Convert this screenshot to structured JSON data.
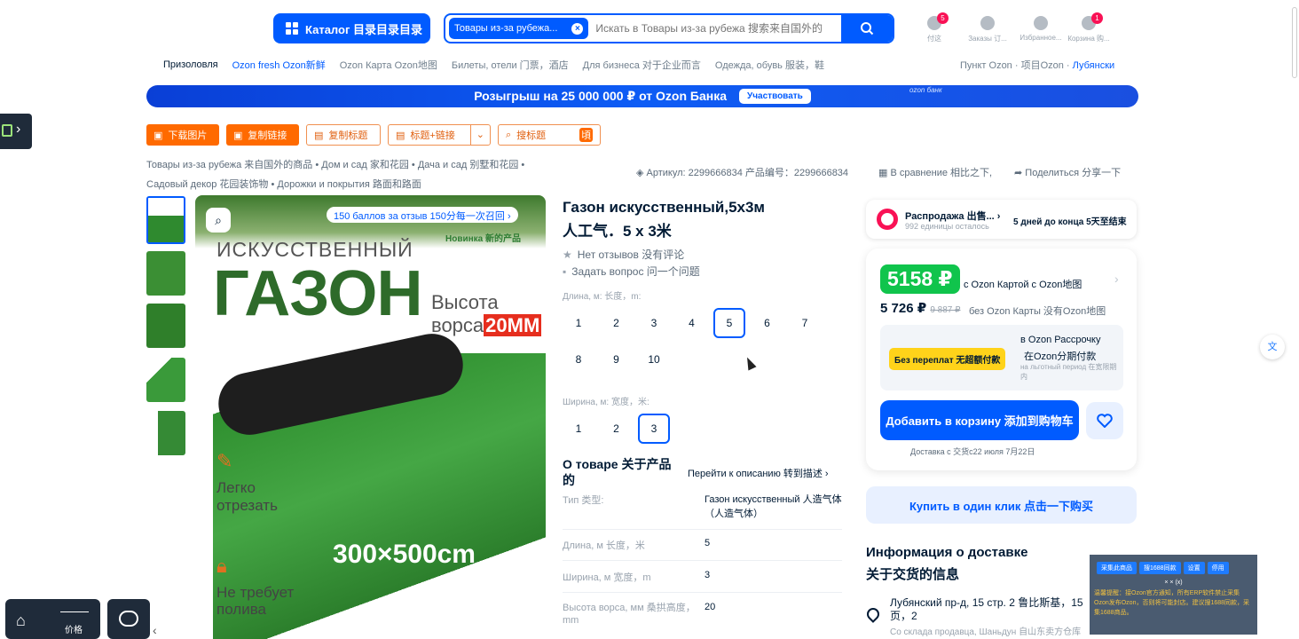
{
  "header": {
    "catalog_label": "Каталог 目录目录目录",
    "search_chip": "Товары из-за рубежа...",
    "search_placeholder": "Искать в Товары из-за рубежа 搜索来自国外的",
    "icons": [
      {
        "label": "付这",
        "badge": "5"
      },
      {
        "label": "Заказы 订...",
        "badge": ""
      },
      {
        "label": "Избранное...",
        "badge": ""
      },
      {
        "label": "Корзина 购...",
        "badge": "1"
      }
    ]
  },
  "subnav": {
    "items": [
      "Призоловля",
      "Ozon fresh Ozon新鲜",
      "Ozon Карта Ozon地图",
      "Билеты, отели 门票，酒店",
      "Для бизнеса 对于企业而言",
      "Одежда, обувь 服装，鞋"
    ],
    "pickup_prefix": "Пункт Ozon · 项目Ozon · ",
    "pickup_place": "Лубянски"
  },
  "banner": {
    "text": "Розыгрыш на 25 000 000 ₽ от Ozon Банка",
    "cta": "Участвовать",
    "logo": "ozon банк"
  },
  "toolbar": {
    "download": "下载图片",
    "copy_link": "复制链接",
    "copy_title": "复制标题",
    "title_link": "标题+链接",
    "search_title": "搜标题"
  },
  "breadcrumbs": {
    "line1": "Товары из-за рубежа 来自国外的商品 • Дом и сад 家和花园 • Дача и сад 别墅和花园 •",
    "line2": "Садовый декор 花园装饰物 • Дорожки и покрытия 路面和路面"
  },
  "meta": {
    "article": "Артикул: 2299666834 产品编号：2299666834",
    "compare": "В сравнение 相比之下,",
    "share": "Поделиться 分享一下"
  },
  "image": {
    "bonus": "150 баллов за отзыв 150分每一次召回",
    "new": "Новинка 新的产品",
    "word1": "ИСКУССТВЕННЫЙ",
    "word2": "ГАЗОН",
    "height1": "Высота",
    "height2": "ворса",
    "height_mm": "20MM",
    "feature1a": "Легко",
    "feature1b": "отрезать",
    "size": "300×500cm",
    "feature2a": "Не требует",
    "feature2b": "полива"
  },
  "product": {
    "title_line1": "Газон искусственный,5х3м",
    "title_line2": "人工气．5 x 3米",
    "reviews": "Нет отзывов 没有评论",
    "question": "Задать вопрос 问一个问题",
    "length_label": "Длина, м: 长度，m:",
    "length_options": [
      "1",
      "2",
      "3",
      "4",
      "5",
      "6",
      "7",
      "8",
      "9",
      "10"
    ],
    "length_selected": "5",
    "width_label": "Ширина, м: 宽度，米:",
    "width_options": [
      "1",
      "2",
      "3"
    ],
    "width_selected": "3"
  },
  "about": {
    "title": "О товаре 关于产品的",
    "link": "Перейти к описанию 转到描述",
    "specs": [
      {
        "k": "Тип 类型:",
        "v": "Газон искусственный 人造气体（人造气体）"
      },
      {
        "k": "Длина, м 长度，米",
        "v": "5"
      },
      {
        "k": "Ширина, м 宽度，m",
        "v": "3"
      },
      {
        "k": "Высота ворса, мм 桑拱高度，mm",
        "v": "20"
      }
    ]
  },
  "sale": {
    "title": "Распродажа 出售...",
    "sub": "992 единицы осталось",
    "days": "5 дней до конца 5天至结束"
  },
  "price": {
    "card_price": "5158 ₽",
    "card_label": "с Ozon Картой с Ozon地图",
    "regular": "5 726 ₽",
    "old": "9 887 ₽",
    "regular_label": "без Ozon Карты 没有Ozon地图",
    "installment_badge": "Без переплат 无超额付款",
    "installment_line1": "в Ozon Рассрочку",
    "installment_line2": "在Ozon分期付款",
    "installment_line3": "на льготный период 在宽限期内",
    "cart": "Добавить в корзину 添加到购物车",
    "delivery": "Доставка с 交货c22 июля 7月22日",
    "one_click": "Купить в один клик 点击一下购买"
  },
  "delivery": {
    "title1": "Информация о доставке",
    "title2": "关于交货的信息",
    "address": "Лубянский пр-д, 15 стр. 2 鲁比斯基，15页，2",
    "seller": "Со склада продавца, Шаньдун 自山东卖方仓库"
  },
  "plugin": {
    "b1": "采集此商品",
    "b2": "搜1688同款",
    "b3": "设置",
    "b4": "停用",
    "close": "× × (x)",
    "text": "温馨提醒：接Ozon官方通知，所有ERP软件禁止采集Ozon发布Ozon，否则将可能封店。建议搜1688同款，采集1688商品。"
  },
  "bottom": {
    "price_label": "价格"
  }
}
